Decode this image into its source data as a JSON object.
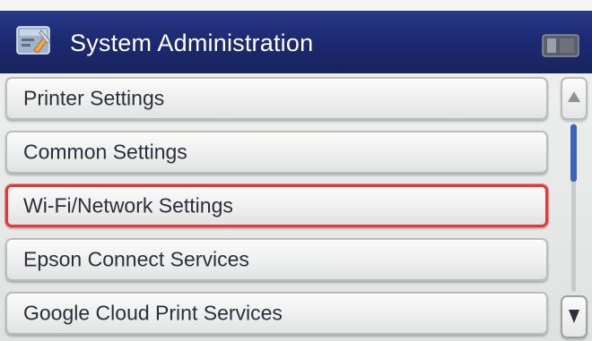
{
  "header": {
    "title": "System Administration",
    "icon": "settings-tools-icon",
    "status_icon": "battery-icon",
    "color": "#1d2a72"
  },
  "menu": {
    "items": [
      {
        "label": "Printer Settings",
        "selected": false
      },
      {
        "label": "Common Settings",
        "selected": false
      },
      {
        "label": "Wi-Fi/Network Settings",
        "selected": true
      },
      {
        "label": "Epson Connect Services",
        "selected": false
      },
      {
        "label": "Google Cloud Print Services",
        "selected": false
      }
    ],
    "selected_border_color": "#e23a3a"
  },
  "scrollbar": {
    "up_icon": "triangle-up-icon",
    "down_icon": "triangle-down-icon",
    "thumb_color": "#3f63b8"
  }
}
